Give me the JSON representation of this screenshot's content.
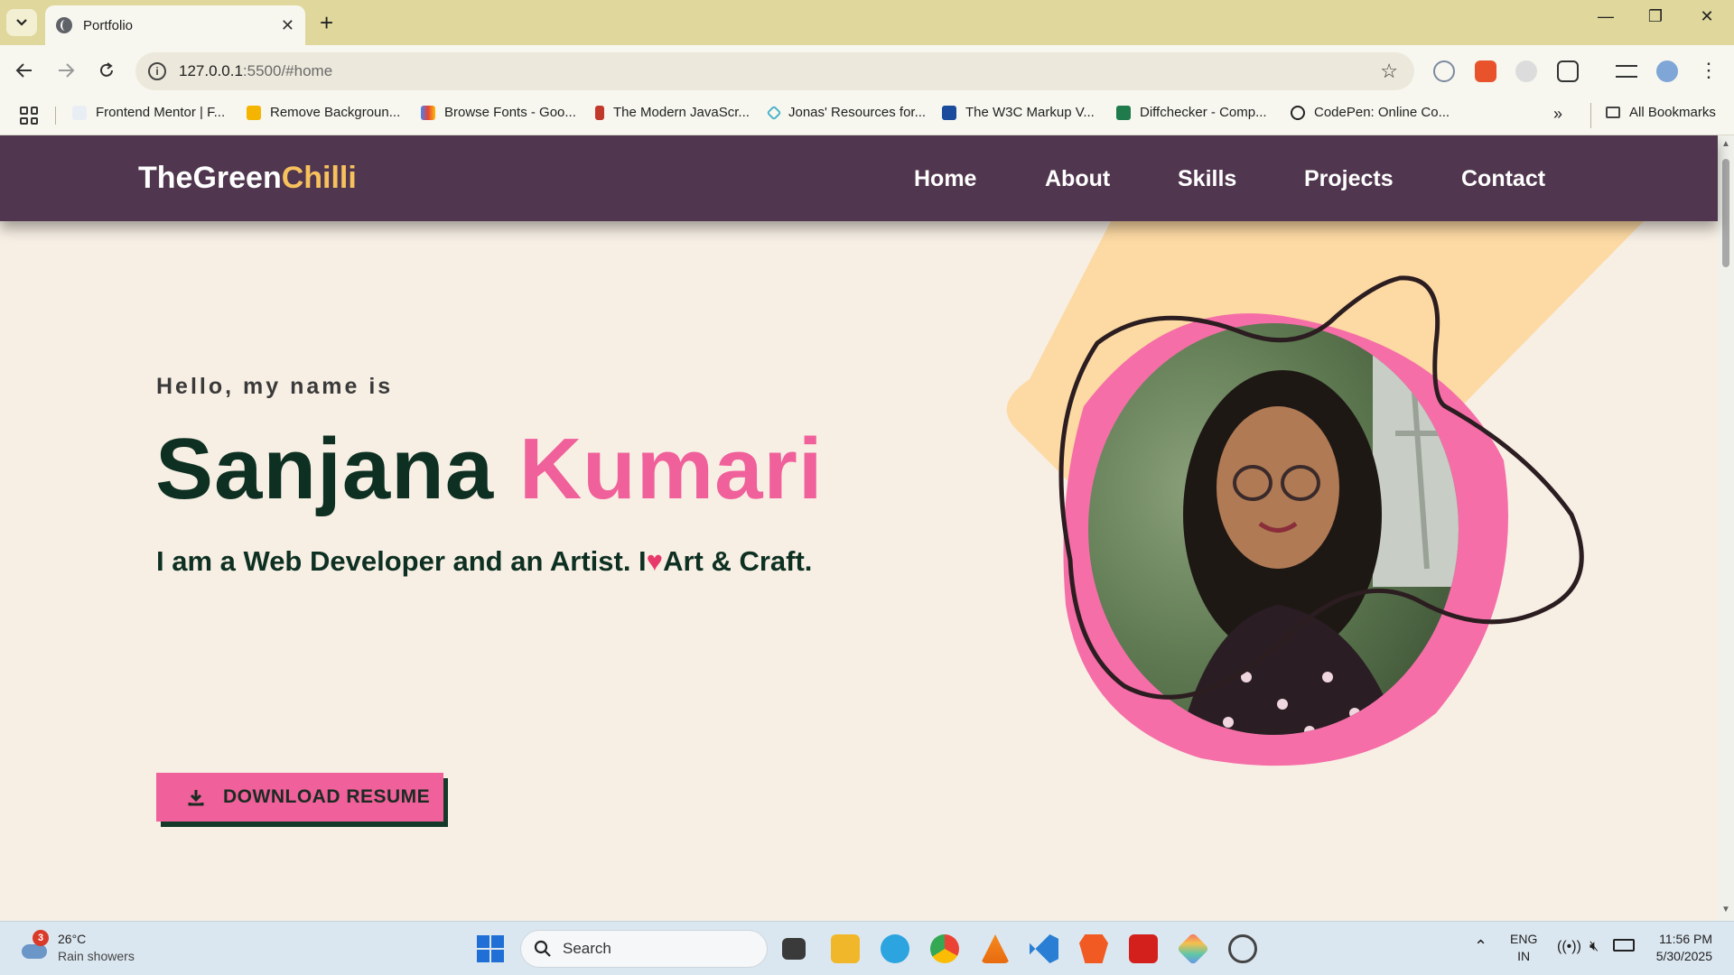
{
  "browser": {
    "tab_title": "Portfolio",
    "url_host": "127.0.0.1",
    "url_rest": ":5500/#home",
    "bookmarks": [
      "Frontend Mentor | F...",
      "Remove Backgroun...",
      "Browse Fonts - Goo...",
      "The Modern JavaScr...",
      "Jonas' Resources for...",
      "The W3C Markup V...",
      "Diffchecker - Comp...",
      "CodePen: Online Co..."
    ],
    "all_bookmarks": "All Bookmarks"
  },
  "site": {
    "logo_main": "TheGreen",
    "logo_accent": "Chilli",
    "nav": [
      "Home",
      "About",
      "Skills",
      "Projects",
      "Contact"
    ],
    "hello": "Hello, my name is",
    "first_name": "Sanjana",
    "last_name": "Kumari",
    "tagline_a": "I am a Web Developer and an Artist. I",
    "tagline_heart": "♥",
    "tagline_b": "Art & Craft.",
    "download_label": "DOWNLOAD RESUME"
  },
  "taskbar": {
    "weather_badge": "3",
    "temperature": "26°C",
    "weather_desc": "Rain showers",
    "search_label": "Search",
    "lang": "ENG",
    "region": "IN",
    "time": "11:56 PM",
    "date": "5/30/2025"
  },
  "colors": {
    "nav_bg": "#50364e",
    "accent_yellow": "#f7c15e",
    "accent_pink": "#f0609a",
    "dark_green": "#0d3022",
    "page_bg": "#f7efe4",
    "peach_shape": "#fdd9a3"
  }
}
